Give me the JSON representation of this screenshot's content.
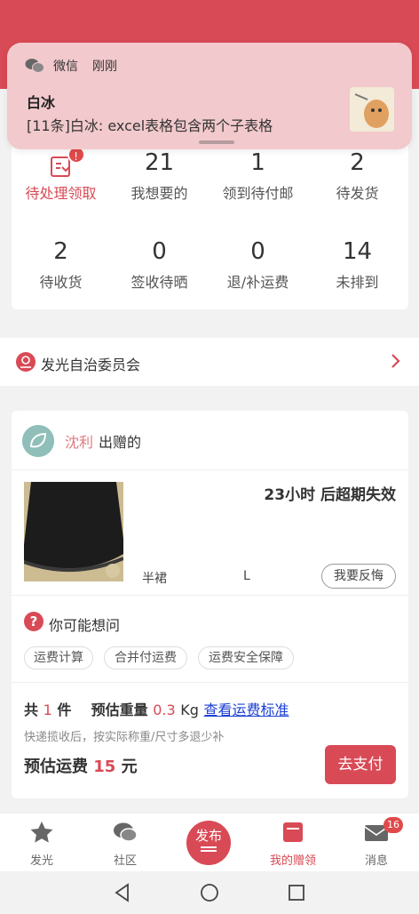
{
  "notification": {
    "app_name": "微信",
    "time": "刚刚",
    "sender": "白冰",
    "message": "[11条]白冰: excel表格包含两个子表格"
  },
  "stats": [
    {
      "value": "",
      "label": "待处理领取",
      "badge": "!"
    },
    {
      "value": "21",
      "label": "我想要的"
    },
    {
      "value": "1",
      "label": "领到待付邮"
    },
    {
      "value": "2",
      "label": "待发货"
    },
    {
      "value": "2",
      "label": "待收货"
    },
    {
      "value": "0",
      "label": "签收待晒"
    },
    {
      "value": "0",
      "label": "退/补运费"
    },
    {
      "value": "14",
      "label": "未排到"
    }
  ],
  "committee": {
    "label": "发光自治委员会"
  },
  "order": {
    "giver_name": "沈利",
    "giver_action": "出赠的",
    "expire_text": "23小时 后超期失效",
    "product_name": "半裙",
    "product_size": "L",
    "regret_label": "我要反悔",
    "ask_title": "你可能想问",
    "tags": [
      "运费计算",
      "合并付运费",
      "运费安全保障"
    ],
    "count_prefix": "共",
    "count": "1",
    "count_unit": "件",
    "weight_label": "预估重量",
    "weight": "0.3",
    "weight_unit": "Kg",
    "shipping_link": "查看运费标准",
    "note": "快递揽收后，按实际称重/尺寸多退少补",
    "fee_label": "预估运费",
    "fee": "15",
    "fee_unit": "元",
    "pay_label": "去支付"
  },
  "tabbar": {
    "tabs": [
      {
        "label": "发光"
      },
      {
        "label": "社区"
      },
      {
        "label": "发布"
      },
      {
        "label": "我的赠领"
      },
      {
        "label": "消息",
        "badge": "16"
      }
    ]
  },
  "colors": {
    "accent": "#d84a55",
    "link": "#1a3fd4"
  }
}
